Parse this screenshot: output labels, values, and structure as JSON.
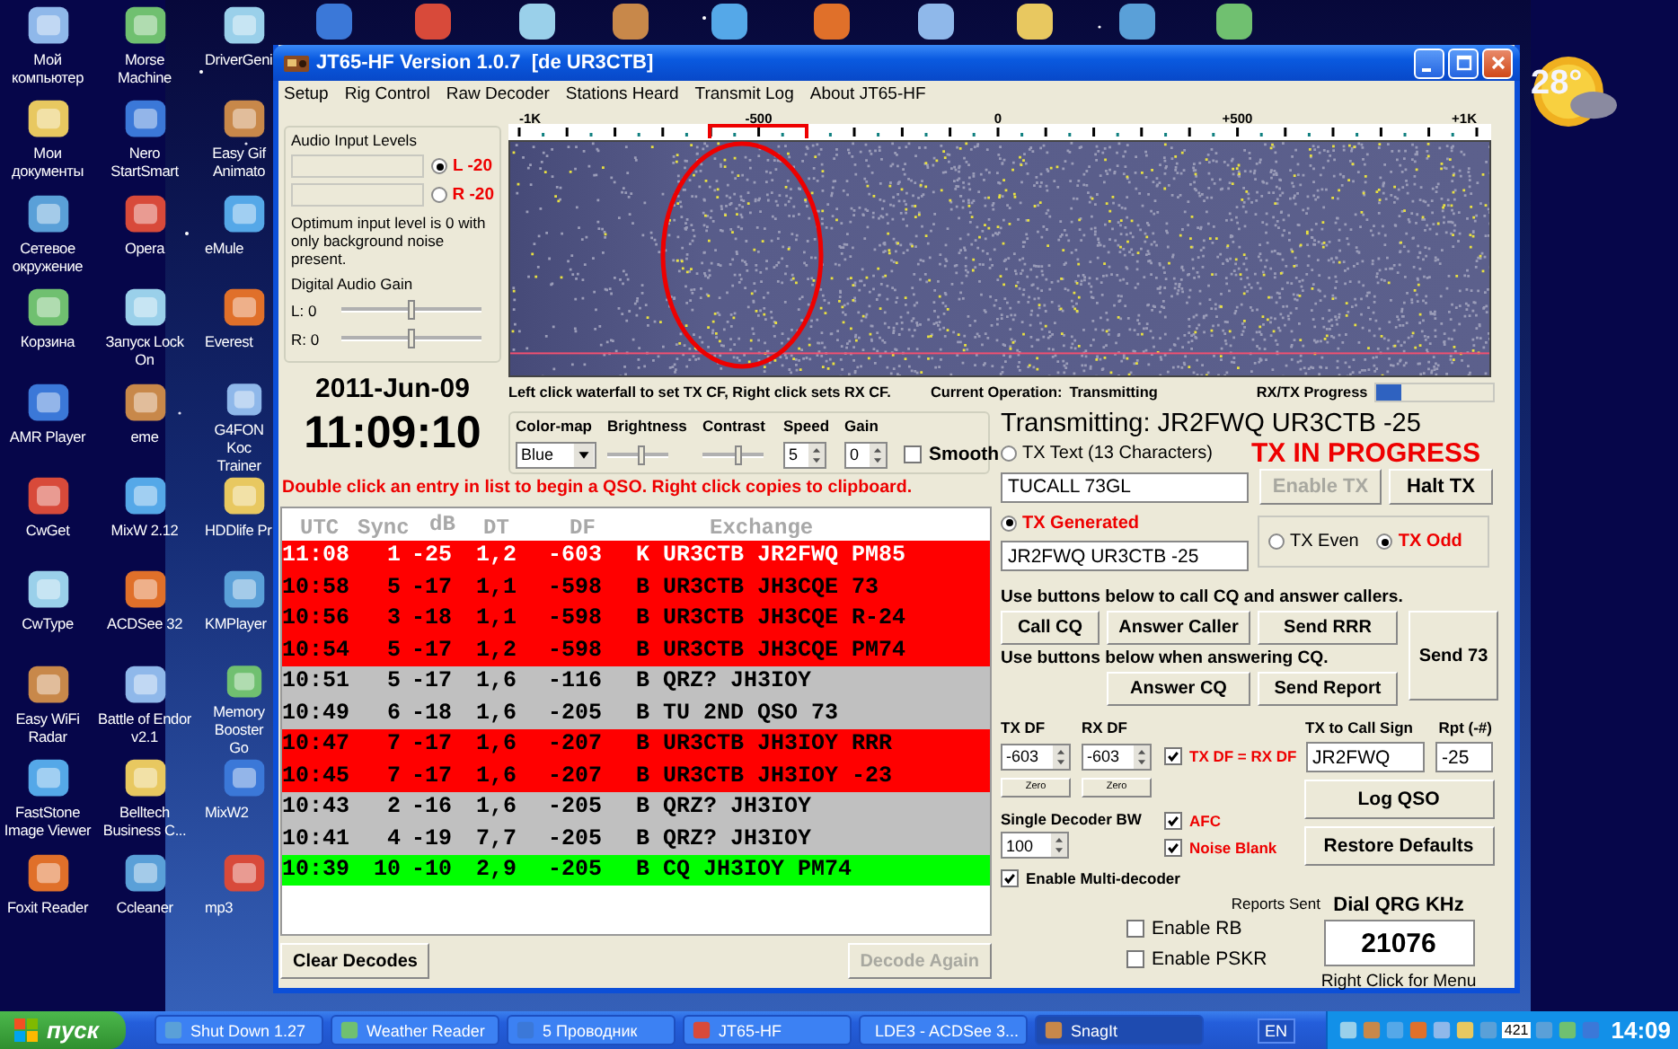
{
  "desktop": {
    "icon_columns": [
      {
        "icons": [
          {
            "label": "Мой компьютер"
          },
          {
            "label": "Мои документы"
          },
          {
            "label": "Сетевое окружение"
          },
          {
            "label": "Корзина"
          },
          {
            "label": "AMR Player"
          },
          {
            "label": "CwGet"
          },
          {
            "label": "CwType"
          },
          {
            "label": "Easy WiFi Radar"
          },
          {
            "label": "FastStone Image Viewer"
          },
          {
            "label": "Foxit Reader"
          }
        ]
      },
      {
        "icons": [
          {
            "label": "Morse Machine"
          },
          {
            "label": "Nero StartSmart"
          },
          {
            "label": "Opera"
          },
          {
            "label": "Запуск Lock On"
          },
          {
            "label": "eme"
          },
          {
            "label": "MixW 2.12"
          },
          {
            "label": "ACDSee 32"
          },
          {
            "label": "Battle of Endor v2.1"
          },
          {
            "label": "Belltech Business C..."
          },
          {
            "label": "Ccleaner"
          }
        ]
      },
      {
        "icons": [
          {
            "label": "DriverGeni"
          },
          {
            "label": "Easy Gif Animato"
          },
          {
            "label": "eMule"
          },
          {
            "label": "Everest"
          },
          {
            "label": "G4FON Koc Trainer"
          },
          {
            "label": "HDDlife Pr"
          },
          {
            "label": "KMPlayer"
          },
          {
            "label": "Memory Booster Go"
          },
          {
            "label": "MixW2"
          },
          {
            "label": "mp3"
          }
        ]
      }
    ],
    "weather": "28°"
  },
  "window": {
    "title": "JT65-HF Version 1.0.7  [de UR3CTB]",
    "menu": [
      "Setup",
      "Rig Control",
      "Raw Decoder",
      "Stations Heard",
      "Transmit Log",
      "About JT65-HF"
    ]
  },
  "audio": {
    "title": "Audio Input Levels",
    "channels": [
      {
        "label": "L -20",
        "selected": true
      },
      {
        "label": "R -20",
        "selected": false
      }
    ],
    "note": "Optimum input level is 0 with only background noise present.",
    "gain_title": "Digital Audio Gain",
    "gains": [
      {
        "label": "L: 0",
        "level": 0.5
      },
      {
        "label": "R: 0",
        "level": 0.5
      }
    ]
  },
  "clock": {
    "date": "2011-Jun-09",
    "time": "11:09:10"
  },
  "waterfall": {
    "scale": [
      "-1K",
      "-500",
      "0",
      "+500",
      "+1K"
    ],
    "hint": "Left click waterfall to set TX CF, Right click sets RX CF.",
    "operation_label": "Current Operation:",
    "operation": "Transmitting",
    "progress_label": "RX/TX Progress",
    "progress": {
      "level": 0.22
    }
  },
  "display_controls": {
    "colormap_label": "Color-map",
    "colormap": "Blue",
    "brightness_label": "Brightness",
    "brightness": {
      "level": 0.55
    },
    "contrast_label": "Contrast",
    "contrast": {
      "level": 0.6
    },
    "speed_label": "Speed",
    "speed": "5",
    "gain_label": "Gain",
    "gain": "0",
    "smooth": {
      "label": "Smooth",
      "checked": false
    }
  },
  "list_hint": "Double click an entry in list to begin a QSO.  Right click copies to clipboard.",
  "decodes": {
    "columns": [
      "UTC",
      "Sync",
      "dB",
      "DT",
      "DF",
      "Exchange"
    ],
    "rows": [
      {
        "utc": "11:08",
        "sync": "1",
        "db": "-25",
        "dt": "1,2",
        "df": "-603",
        "mode": "K",
        "exchange": "UR3CTB JR2FWQ PM85",
        "color": "#ff0000",
        "selected": true
      },
      {
        "utc": "10:58",
        "sync": "5",
        "db": "-17",
        "dt": "1,1",
        "df": "-598",
        "mode": "B",
        "exchange": "UR3CTB JH3CQE 73",
        "color": "#ff0000",
        "selected": false
      },
      {
        "utc": "10:56",
        "sync": "3",
        "db": "-18",
        "dt": "1,1",
        "df": "-598",
        "mode": "B",
        "exchange": "UR3CTB JH3CQE R-24",
        "color": "#ff0000",
        "selected": false
      },
      {
        "utc": "10:54",
        "sync": "5",
        "db": "-17",
        "dt": "1,2",
        "df": "-598",
        "mode": "B",
        "exchange": "UR3CTB JH3CQE PM74",
        "color": "#ff0000",
        "selected": false
      },
      {
        "utc": "10:51",
        "sync": "5",
        "db": "-17",
        "dt": "1,6",
        "df": "-116",
        "mode": "B",
        "exchange": "QRZ? JH3IOY",
        "color": "#c0c0c0",
        "selected": false
      },
      {
        "utc": "10:49",
        "sync": "6",
        "db": "-18",
        "dt": "1,6",
        "df": "-205",
        "mode": "B",
        "exchange": "TU 2ND QSO 73",
        "color": "#c0c0c0",
        "selected": false
      },
      {
        "utc": "10:47",
        "sync": "7",
        "db": "-17",
        "dt": "1,6",
        "df": "-207",
        "mode": "B",
        "exchange": "UR3CTB JH3IOY RRR",
        "color": "#ff0000",
        "selected": false
      },
      {
        "utc": "10:45",
        "sync": "7",
        "db": "-17",
        "dt": "1,6",
        "df": "-207",
        "mode": "B",
        "exchange": "UR3CTB JH3IOY -23",
        "color": "#ff0000",
        "selected": false
      },
      {
        "utc": "10:43",
        "sync": "2",
        "db": "-16",
        "dt": "1,6",
        "df": "-205",
        "mode": "B",
        "exchange": "QRZ? JH3IOY",
        "color": "#c0c0c0",
        "selected": false
      },
      {
        "utc": "10:41",
        "sync": "4",
        "db": "-19",
        "dt": "7,7",
        "df": "-205",
        "mode": "B",
        "exchange": "QRZ? JH3IOY",
        "color": "#c0c0c0",
        "selected": false
      },
      {
        "utc": "10:39",
        "sync": "10",
        "db": "-10",
        "dt": "2,9",
        "df": "-205",
        "mode": "B",
        "exchange": "CQ JH3IOY PM74",
        "color": "#00ff00",
        "selected": false
      }
    ]
  },
  "list_buttons": [
    {
      "label": "Clear Decodes",
      "disabled": false
    },
    {
      "label": "Decode Again",
      "disabled": true
    }
  ],
  "tx": {
    "status": "Transmitting: JR2FWQ UR3CTB -25",
    "in_progress": {
      "label": "TX IN PROGRESS",
      "on": true
    },
    "sources": [
      {
        "label": "TX Text (13 Characters)",
        "selected": false,
        "value": "TUCALL 73GL"
      },
      {
        "label": "TX Generated",
        "selected": true,
        "value": "JR2FWQ UR3CTB -25"
      }
    ],
    "tx_buttons": [
      {
        "label": "Enable TX",
        "disabled": true
      },
      {
        "label": "Halt TX",
        "disabled": false
      }
    ],
    "periods": [
      {
        "label": "TX Even",
        "selected": false
      },
      {
        "label": "TX Odd",
        "selected": true
      }
    ],
    "cq_hint": "Use buttons below to call CQ and answer callers.",
    "cq_buttons": [
      "Call CQ",
      "Answer Caller",
      "Send RRR"
    ],
    "answer_hint": "Use buttons below when answering CQ.",
    "answer_buttons": [
      "Answer CQ",
      "Send Report"
    ],
    "send73": "Send 73",
    "dfs": [
      {
        "label": "TX DF",
        "value": "-603",
        "zero": "Zero"
      },
      {
        "label": "RX DF",
        "value": "-603",
        "zero": "Zero"
      }
    ],
    "lock": {
      "label": "TX DF = RX DF",
      "checked": true
    },
    "call_label": "TX to Call Sign",
    "call": "JR2FWQ",
    "rpt_label": "Rpt (-#)",
    "rpt": "-25",
    "log_button": "Log QSO",
    "restore_button": "Restore Defaults",
    "bw_label": "Single Decoder BW",
    "bw": "100",
    "options": [
      {
        "label": "AFC",
        "checked": true
      },
      {
        "label": "Noise Blank",
        "checked": true
      }
    ],
    "multi": {
      "label": "Enable Multi-decoder",
      "checked": true
    },
    "reports_label": "Reports Sent",
    "reports": [
      {
        "label": "Enable RB",
        "checked": false
      },
      {
        "label": "Enable PSKR",
        "checked": false
      }
    ],
    "dial_label": "Dial QRG KHz",
    "dial": "21076",
    "dial_hint": "Right Click for Menu"
  },
  "taskbar": {
    "start": "пуск",
    "tasks": [
      {
        "label": "Shut Down 1.27",
        "selected": false
      },
      {
        "label": "Weather Reader",
        "selected": false
      },
      {
        "label": "5 Проводник",
        "selected": false
      },
      {
        "label": "JT65-HF",
        "selected": false
      },
      {
        "label": "LDE3 - ACDSee 3...",
        "selected": false
      },
      {
        "label": "SnagIt",
        "selected": true
      }
    ],
    "lang": "EN",
    "tray_badge": "421",
    "clock": "14:09"
  }
}
